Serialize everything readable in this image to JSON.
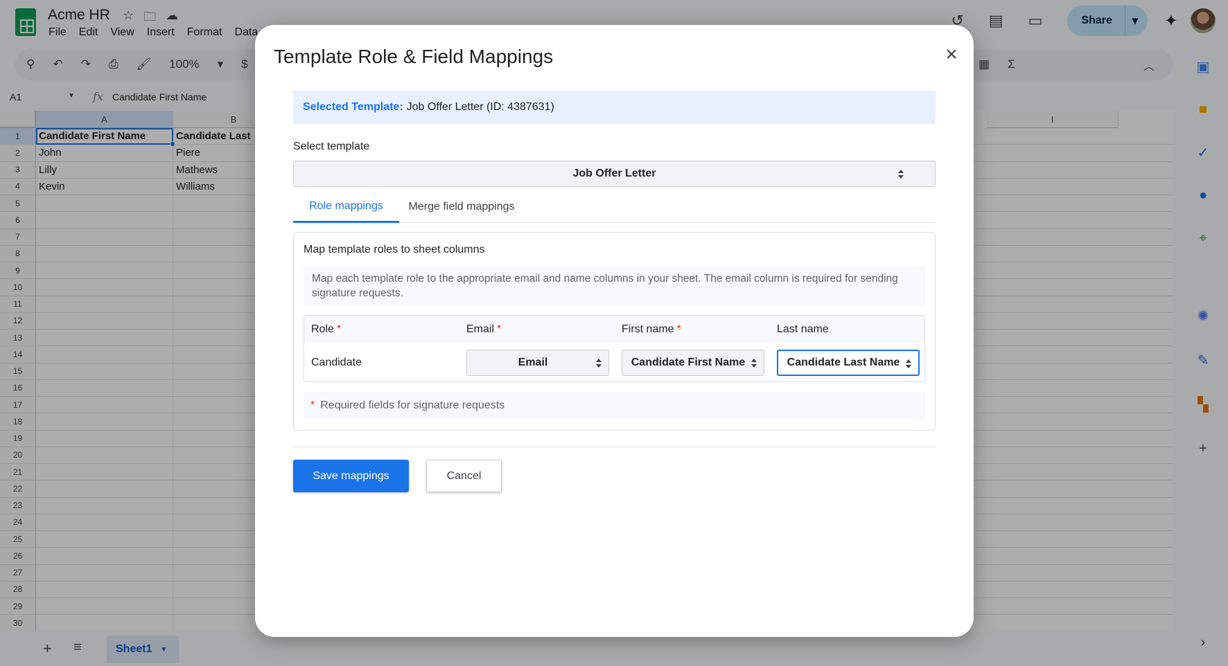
{
  "app": {
    "doc_title": "Acme HR",
    "menu": [
      "File",
      "Edit",
      "View",
      "Insert",
      "Format",
      "Data"
    ],
    "share_label": "Share",
    "zoom": "100%",
    "currency_symbol": "$",
    "sum_symbol": "Σ"
  },
  "formula_bar": {
    "cell_ref": "A1",
    "fx_label": "fx",
    "value": "Candidate First Name"
  },
  "grid": {
    "columns": [
      "A",
      "B",
      "I"
    ],
    "row_numbers": [
      "1",
      "2",
      "3",
      "4",
      "5",
      "6",
      "7",
      "8",
      "9",
      "10",
      "11",
      "12",
      "13",
      "14",
      "15",
      "16",
      "17",
      "18",
      "19",
      "20",
      "21",
      "22",
      "23",
      "24",
      "25",
      "26",
      "27",
      "28",
      "29",
      "30"
    ],
    "rows": [
      {
        "a": "Candidate First Name",
        "b": "Candidate Last"
      },
      {
        "a": "John",
        "b": "Piere"
      },
      {
        "a": "Lilly",
        "b": "Mathews"
      },
      {
        "a": "Kevin",
        "b": "Williams"
      }
    ]
  },
  "sheet_tab": {
    "label": "Sheet1"
  },
  "dialog": {
    "title": "Template Role & Field Mappings",
    "close_icon": "×",
    "selected_template_label": "Selected Template:",
    "selected_template_value": "Job Offer Letter (ID: 4387631)",
    "select_label": "Select template",
    "select_value": "Job Offer Letter",
    "tabs": [
      {
        "label": "Role mappings",
        "active": true
      },
      {
        "label": "Merge field mappings",
        "active": false
      }
    ],
    "panel_heading": "Map template roles to sheet columns",
    "panel_description": "Map each template role to the appropriate email and name columns in your sheet. The email column is required for sending signature requests.",
    "table_headers": {
      "role": "Role",
      "email": "Email",
      "first_name": "First name",
      "last_name": "Last name"
    },
    "required_marker": "*",
    "mapping_row": {
      "role": "Candidate",
      "email": "Email",
      "first_name": "Candidate First Name",
      "last_name": "Candidate Last Name"
    },
    "required_note": "Required fields for signature requests",
    "save_label": "Save mappings",
    "cancel_label": "Cancel"
  },
  "colors": {
    "accent": "#1a73e8",
    "required": "#d93025",
    "banner_bg": "#e8f0fe"
  }
}
